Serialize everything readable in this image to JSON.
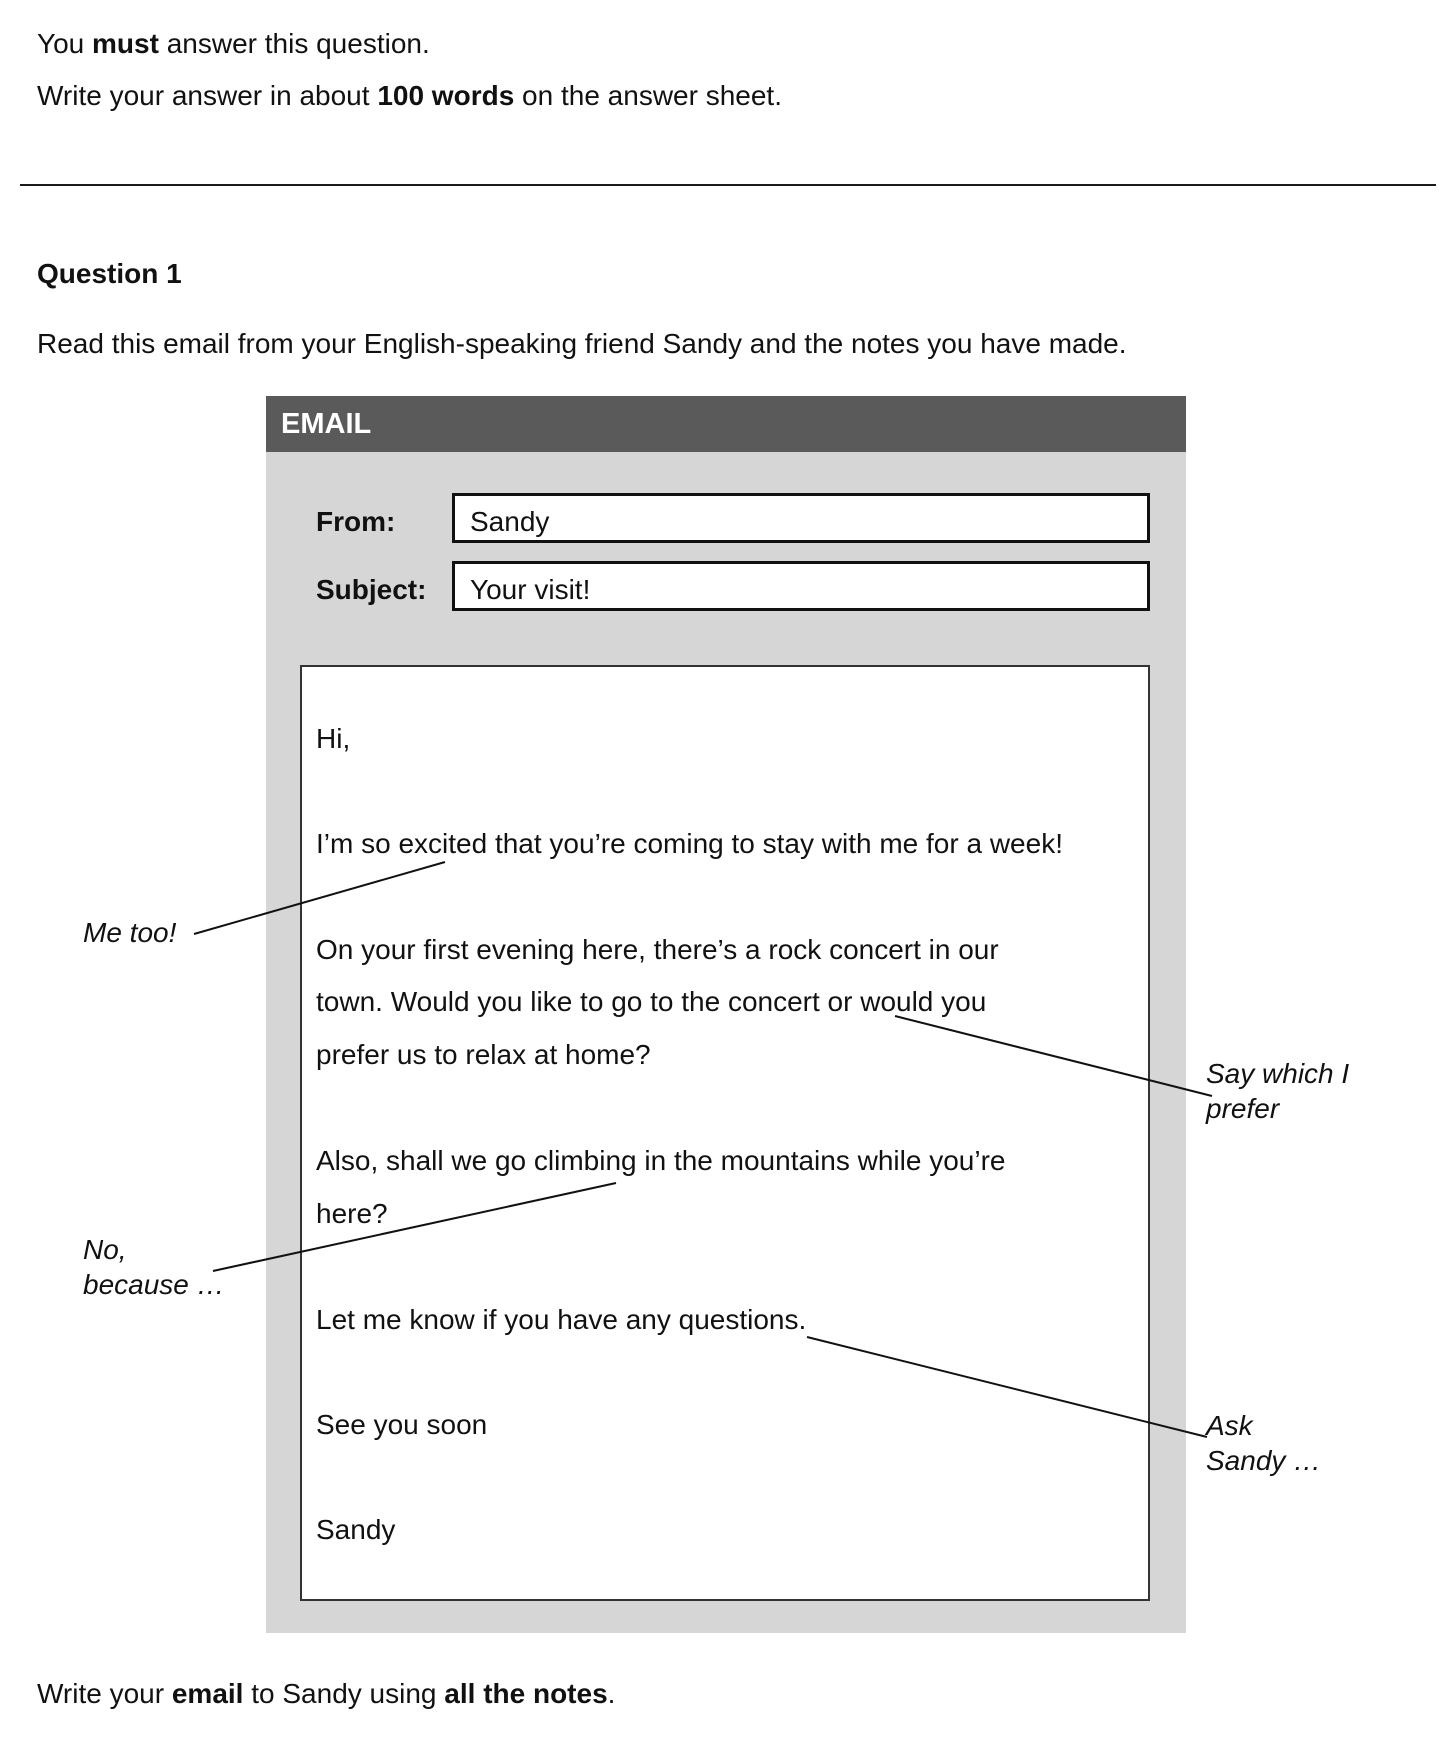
{
  "instructions": {
    "line1": {
      "pre": "You ",
      "bold": "must",
      "post": " answer this question."
    },
    "line2": {
      "pre": "Write your answer in about ",
      "bold": "100 words",
      "post": " on the answer sheet."
    }
  },
  "question": {
    "title": "Question 1",
    "prompt": "Read this email from your English-speaking friend Sandy and the notes you have made."
  },
  "email": {
    "header_title": "EMAIL",
    "from_label": "From:",
    "from_value": "Sandy",
    "subject_label": "Subject:",
    "subject_value": "Your visit!",
    "body": {
      "greeting": "Hi,",
      "para1": "I’m so excited that you’re coming to stay with me for a week!",
      "para2_line1": "On your first evening here, there’s a rock concert in our",
      "para2_line2": "town. Would you like to go to the concert or would you",
      "para2_line3": "prefer us to relax at home?",
      "para3_line1": "Also, shall we go climbing in the mountains while you’re",
      "para3_line2": "here?",
      "para4": "Let me know if you have any questions.",
      "closing": "See you soon",
      "signature": "Sandy"
    }
  },
  "notes": {
    "me_too": "Me too!",
    "say_which_line1": "Say which I",
    "say_which_line2": "prefer",
    "no_because_line1": "No,",
    "no_because_line2": "because …",
    "ask_sandy_line1": "Ask",
    "ask_sandy_line2": "Sandy …"
  },
  "final_instruction": {
    "pre": "Write your ",
    "bold1": "email",
    "mid": " to Sandy using ",
    "bold2": "all the notes",
    "post": "."
  },
  "colors": {
    "header_bg": "#5a5a5a",
    "panel_bg": "#d6d6d6",
    "text": "#111111"
  }
}
